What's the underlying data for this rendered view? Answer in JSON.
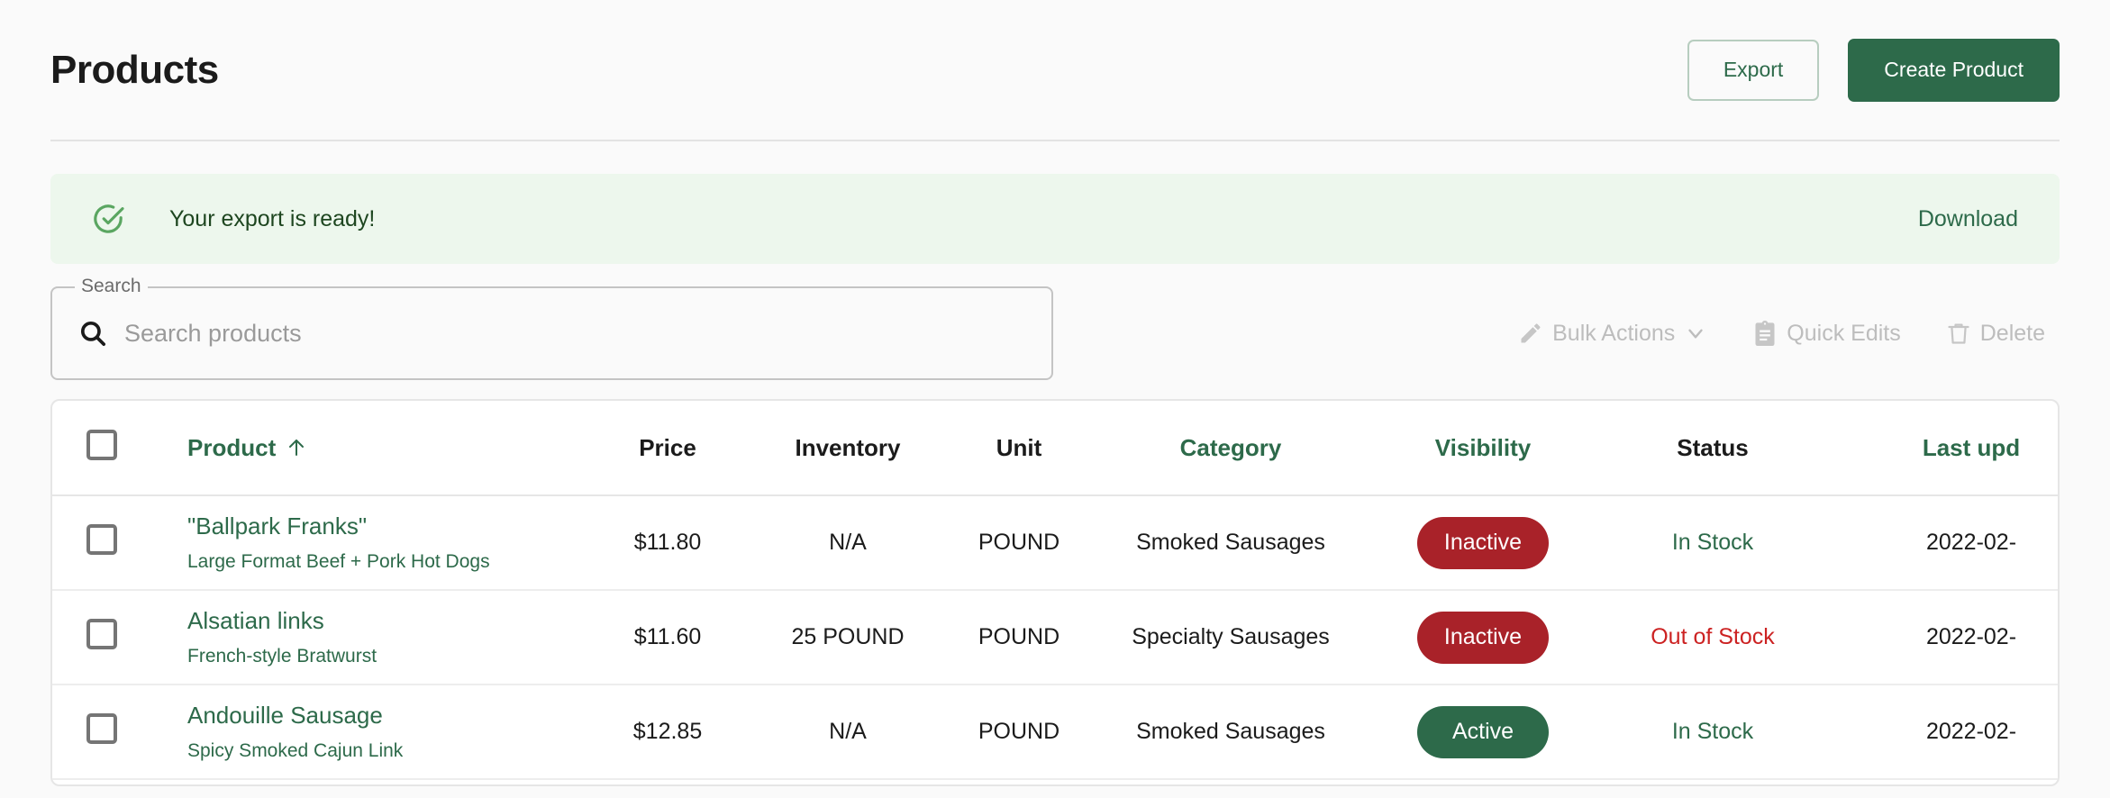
{
  "header": {
    "title": "Products",
    "export_label": "Export",
    "create_label": "Create Product"
  },
  "alert": {
    "icon": "check-circle-icon",
    "message": "Your export is ready!",
    "action_label": "Download",
    "bg_color": "#edf7ed",
    "text_color": "#1e4620"
  },
  "toolbar": {
    "search_label": "Search",
    "search_value": "",
    "search_placeholder": "Search products",
    "search_icon": "search-icon",
    "actions": [
      {
        "label": "Bulk Actions",
        "icon": "pencil-icon",
        "has_chevron": true,
        "disabled": true
      },
      {
        "label": "Quick Edits",
        "icon": "clipboard-icon",
        "has_chevron": false,
        "disabled": true
      },
      {
        "label": "Delete",
        "icon": "trash-icon",
        "has_chevron": false,
        "disabled": true
      }
    ]
  },
  "table": {
    "select_all_checkbox": false,
    "sort_column": "Product",
    "sort_direction": "asc",
    "sort_arrow": "arrow-up-icon",
    "columns": [
      {
        "label": "Product",
        "color": "green",
        "sortable": true
      },
      {
        "label": "Price",
        "color": "dark",
        "sortable": false
      },
      {
        "label": "Inventory",
        "color": "dark",
        "sortable": false
      },
      {
        "label": "Unit",
        "color": "dark",
        "sortable": false
      },
      {
        "label": "Category",
        "color": "green",
        "sortable": false
      },
      {
        "label": "Visibility",
        "color": "green",
        "sortable": false
      },
      {
        "label": "Status",
        "color": "dark",
        "sortable": false
      },
      {
        "label": "Last upd",
        "color": "green",
        "sortable": false
      }
    ],
    "rows": [
      {
        "selected": false,
        "name": "\"Ballpark Franks\"",
        "subtitle": "Large Format Beef + Pork Hot Dogs",
        "price": "$11.80",
        "inventory": "N/A",
        "unit": "POUND",
        "category": "Smoked Sausages",
        "visibility": "Inactive",
        "visibility_state": "inactive",
        "status": "In Stock",
        "status_state": "in",
        "last_updated": "2022-02-"
      },
      {
        "selected": false,
        "name": "Alsatian links",
        "subtitle": "French-style Bratwurst",
        "price": "$11.60",
        "inventory": "25 POUND",
        "unit": "POUND",
        "category": "Specialty Sausages",
        "visibility": "Inactive",
        "visibility_state": "inactive",
        "status": "Out of Stock",
        "status_state": "out",
        "last_updated": "2022-02-"
      },
      {
        "selected": false,
        "name": "Andouille Sausage",
        "subtitle": "Spicy Smoked Cajun Link",
        "price": "$12.85",
        "inventory": "N/A",
        "unit": "POUND",
        "category": "Smoked Sausages",
        "visibility": "Active",
        "visibility_state": "active",
        "status": "In Stock",
        "status_state": "in",
        "last_updated": "2022-02-"
      }
    ]
  },
  "colors": {
    "brand_green": "#2d6a4a",
    "danger_red": "#a92229",
    "status_out_red": "#cc2222",
    "alert_bg": "#edf7ed",
    "page_bg": "#fafafa"
  }
}
